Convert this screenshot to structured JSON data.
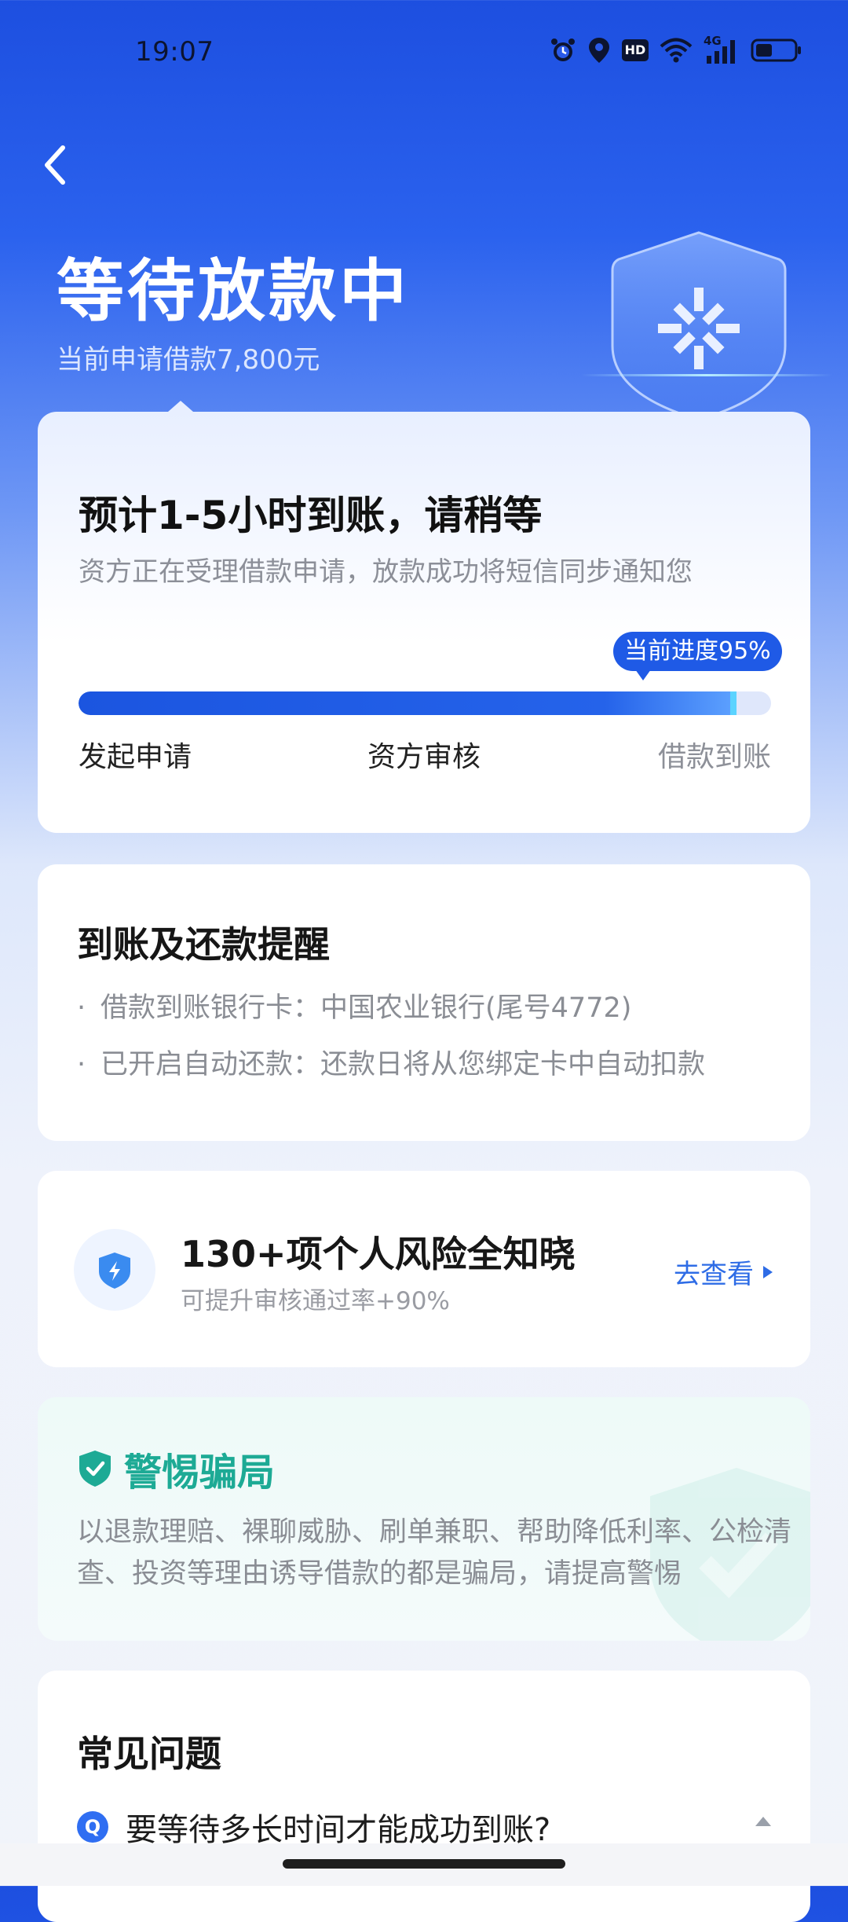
{
  "status_bar": {
    "time": "19:07",
    "icons": [
      "alarm-icon",
      "location-icon",
      "hd-icon",
      "wifi-icon",
      "signal-4g-icon",
      "battery-icon"
    ],
    "hd_label": "HD",
    "network_label": "4G"
  },
  "header": {
    "back_icon": "back-arrow-icon",
    "title": "等待放款中",
    "subtitle": "当前申请借款7,800元"
  },
  "progress_card": {
    "title": "预计1-5小时到账，请稍等",
    "subtitle": "资方正在受理借款申请，放款成功将短信同步通知您",
    "badge": "当前进度95%",
    "progress_fraction": 0.95,
    "steps": [
      "发起申请",
      "资方审核",
      "借款到账"
    ]
  },
  "reminder_card": {
    "title": "到账及还款提醒",
    "lines": [
      "借款到账银行卡：中国农业银行(尾号4772)",
      "已开启自动还款：还款日将从您绑定卡中自动扣款"
    ]
  },
  "risk_card": {
    "icon": "shield-lightning-icon",
    "title": "130+项个人风险全知晓",
    "subtitle": "可提升审核通过率+90%",
    "link": "去查看"
  },
  "fraud_card": {
    "icon": "shield-check-icon",
    "title": "警惕骗局",
    "text": "以退款理赔、裸聊威胁、刷单兼职、帮助降低利率、公检清查、投资等理由诱导借款的都是骗局，请提高警惕"
  },
  "faq_card": {
    "title": "常见问题",
    "badge": "Q",
    "question": "要等待多长时间才能成功到账?"
  },
  "colors": {
    "primary": "#1f5ae6",
    "fraud_green": "#1daa95",
    "link_blue": "#2e6ce6"
  }
}
